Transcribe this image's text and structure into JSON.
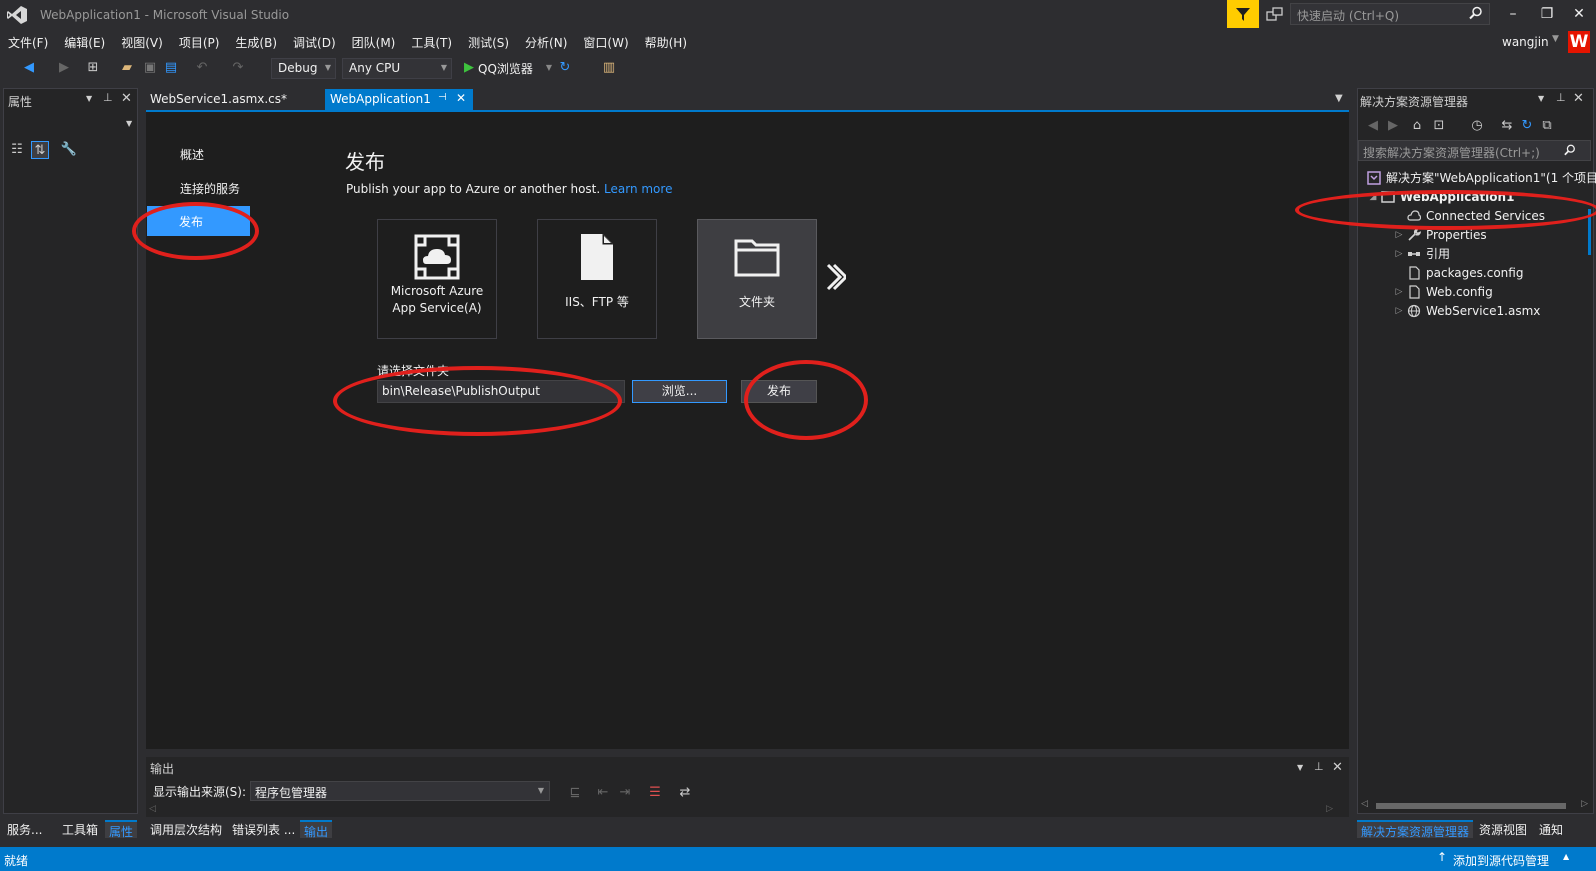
{
  "window": {
    "title": "WebApplication1 - Microsoft Visual Studio",
    "quick_launch_placeholder": "快速启动 (Ctrl+Q)",
    "user_name": "wangjin",
    "user_initial": "W"
  },
  "menu": [
    "文件(F)",
    "编辑(E)",
    "视图(V)",
    "项目(P)",
    "生成(B)",
    "调试(D)",
    "团队(M)",
    "工具(T)",
    "测试(S)",
    "分析(N)",
    "窗口(W)",
    "帮助(H)"
  ],
  "toolbar": {
    "configuration": "Debug",
    "platform": "Any CPU",
    "run_target": "QQ浏览器"
  },
  "properties_panel": {
    "title": "属性"
  },
  "tabs": [
    {
      "label": "WebService1.asmx.cs*",
      "active": false
    },
    {
      "label": "WebApplication1",
      "active": true
    }
  ],
  "publish_page": {
    "nav": [
      "概述",
      "连接的服务",
      "发布"
    ],
    "heading": "发布",
    "description": "Publish your app to Azure or another host.",
    "learn_more": "Learn more",
    "targets": [
      {
        "line1": "Microsoft Azure",
        "line2": "App Service(A)",
        "icon": "azure-cloud-icon"
      },
      {
        "line1": "IIS、FTP 等",
        "line2": "",
        "icon": "document-icon"
      },
      {
        "line1": "文件夹",
        "line2": "",
        "icon": "folder-icon",
        "selected": true
      }
    ],
    "folder_label": "请选择文件夹",
    "folder_value": "bin\\Release\\PublishOutput",
    "browse_label": "浏览...",
    "publish_label": "发布"
  },
  "output_panel": {
    "title": "输出",
    "source_label": "显示输出来源(S):",
    "source_value": "程序包管理器"
  },
  "bottom_tabs_left": [
    "服务...",
    "工具箱",
    "属性"
  ],
  "bottom_tabs_center": [
    "调用层次结构",
    "错误列表 ...",
    "输出"
  ],
  "bottom_tabs_right": [
    "解决方案资源管理器",
    "资源视图",
    "通知"
  ],
  "solution_explorer": {
    "title": "解决方案资源管理器",
    "search_placeholder": "搜索解决方案资源管理器(Ctrl+;)",
    "tree": [
      {
        "label": "解决方案\"WebApplication1\"(1 个项目",
        "level": 0,
        "arrow": "",
        "icon": "solution-icon"
      },
      {
        "label": "WebApplication1",
        "level": 0,
        "arrow": "◢",
        "icon": "project-icon"
      },
      {
        "label": "Connected Services",
        "level": 1,
        "arrow": "",
        "icon": "cloud-icon"
      },
      {
        "label": "Properties",
        "level": 1,
        "arrow": "▷",
        "icon": "wrench-icon"
      },
      {
        "label": "引用",
        "level": 1,
        "arrow": "▷",
        "icon": "references-icon"
      },
      {
        "label": "packages.config",
        "level": 1,
        "arrow": "",
        "icon": "config-file-icon"
      },
      {
        "label": "Web.config",
        "level": 1,
        "arrow": "▷",
        "icon": "config-file-icon"
      },
      {
        "label": "WebService1.asmx",
        "level": 1,
        "arrow": "▷",
        "icon": "web-service-icon"
      }
    ]
  },
  "status": {
    "left": "就绪",
    "right": "添加到源代码管理"
  },
  "colors": {
    "accent": "#007acc",
    "highlight": "#3399ff",
    "annotation": "#e0201c",
    "alert": "#ffcc00"
  }
}
